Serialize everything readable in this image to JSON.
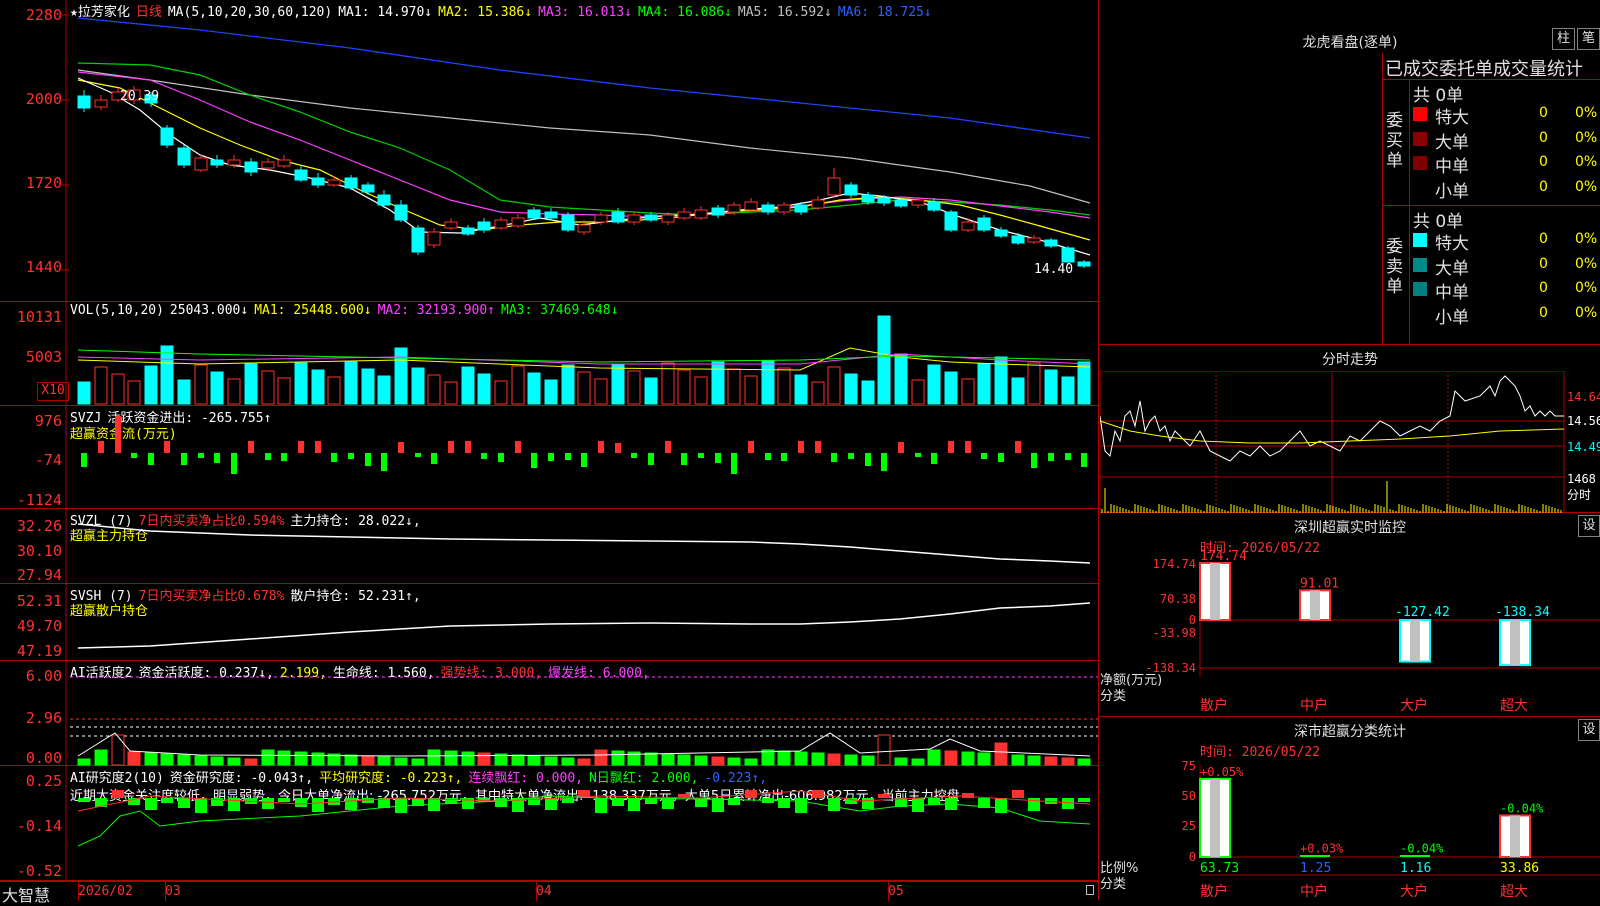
{
  "main": {
    "title": "★拉芳家化",
    "period": "日线",
    "ma_header": "MA(5,10,20,30,60,120)",
    "ma1": "MA1: 14.970↓",
    "ma2": "MA2: 15.386↓",
    "ma3": "MA3: 16.013↓",
    "ma4": "MA4: 16.086↓",
    "ma5": "MA5: 16.592↓",
    "ma6": "MA6: 18.725↓",
    "y_labels": [
      "2280",
      "2000",
      "1720",
      "1440"
    ],
    "high_label": "20.39",
    "low_label": "14.40"
  },
  "vol": {
    "header": "VOL(5,10,20)",
    "value": "25043.000↓",
    "ma1": "MA1: 25448.600↓",
    "ma2": "MA2: 32193.900↑",
    "ma3": "MA3: 37469.648↓",
    "y_labels": [
      "10131",
      "5003"
    ],
    "unit": "X10"
  },
  "svzj": {
    "header": "SVZJ",
    "label": "活跃资金进出: -265.755↑",
    "sub": "超赢资金流(万元)",
    "y_labels": [
      "976",
      "-74",
      "-1124"
    ]
  },
  "svzl": {
    "header": "SVZL (7)",
    "label1": "7日内买卖净占比0.594%",
    "label2": "主力持仓: 28.022↓,",
    "sub": "超赢主力持仓",
    "y_labels": [
      "32.26",
      "30.10",
      "27.94"
    ]
  },
  "svsh": {
    "header": "SVSH (7)",
    "label1": "7日内买卖净占比0.678%",
    "label2": "散户持仓: 52.231↑,",
    "sub": "超赢散户持仓",
    "y_labels": [
      "52.31",
      "49.70",
      "47.19"
    ]
  },
  "ai1": {
    "header": "AI活跃度2",
    "l1": "资金活跃度: 0.237↓,",
    "l2": "2.199,",
    "l3": "生命线: 1.560,",
    "l4": "强势线: 3.000,",
    "l5": "爆发线: 6.000,",
    "y_labels": [
      "6.00",
      "2.96",
      "0.00"
    ]
  },
  "ai2": {
    "header": "AI研究度2(10)",
    "l1": "资金研究度: -0.043↑,",
    "l2": "平均研究度: -0.223↑,",
    "l3": "连续飘红: 0.000,",
    "l4": "N日飘红: 2.000,",
    "l5": "-0.223↑,",
    "comment": "近期大资金关注度较低，明显弱势，今日大单净流出: -265.752万元，其中特大单净流出: -138.337万元，大单5日累计净出-606.982万元，当前主力控盘",
    "y_labels": [
      "0.25",
      "-0.14",
      "-0.52"
    ]
  },
  "bottom": {
    "brand": "大智慧",
    "dates": [
      "2026/02",
      "03",
      "04",
      "05"
    ]
  },
  "dragon": {
    "title": "龙虎看盘(逐单)",
    "btn1": "柱",
    "btn2": "笔",
    "subtitle": "已成交委托单成交量统计",
    "buy_label": "委买单",
    "sell_label": "委卖单",
    "buy_total": "共 0单",
    "sell_total": "共 0单",
    "rows": [
      {
        "name": "特大",
        "val": "0",
        "pct": "0%"
      },
      {
        "name": "大单",
        "val": "0",
        "pct": "0%"
      },
      {
        "name": "中单",
        "val": "0",
        "pct": "0%"
      },
      {
        "name": "小单",
        "val": "0",
        "pct": "0%"
      }
    ],
    "buy_colors": [
      "#ff0000",
      "#8b0000",
      "#800000",
      ""
    ],
    "sell_colors": [
      "#00ffff",
      "#008b8b",
      "#008080",
      ""
    ]
  },
  "intraday": {
    "title": "分时走势",
    "prices": [
      "14.64",
      "14.56",
      "14.49"
    ],
    "vol_label": "1468",
    "vol_unit": "分时"
  },
  "monitor": {
    "title": "深圳超赢实时监控",
    "btn": "设",
    "time": "时间: 2026/05/22",
    "y_labels": [
      "174.74",
      "70.38",
      "0",
      "-33.98",
      "-138.34"
    ],
    "axis_title": "净额(万元)",
    "axis_sub": "分类",
    "categories": [
      "散户",
      "中户",
      "大户",
      "超大"
    ],
    "values": [
      "174.74",
      "91.01",
      "-127.42",
      "-138.34"
    ]
  },
  "classify": {
    "title": "深市超赢分类统计",
    "btn": "设",
    "time": "时间: 2026/05/22",
    "y_labels": [
      "75",
      "50",
      "25",
      "0"
    ],
    "axis_title": "比例%",
    "axis_sub": "分类",
    "categories": [
      "散户",
      "中户",
      "大户",
      "超大"
    ],
    "top_labels": [
      "+0.05%",
      "+0.03%",
      "-0.04%",
      "-0.04%"
    ],
    "values": [
      "63.73",
      "1.25",
      "1.16",
      "33.86"
    ]
  }
}
